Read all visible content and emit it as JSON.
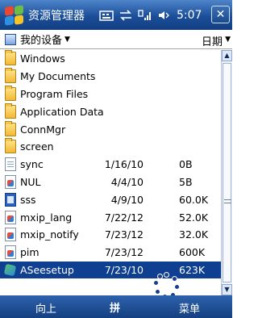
{
  "titlebar": {
    "title": "资源管理器",
    "time": "5:07",
    "close_label": "✕"
  },
  "location": {
    "current": "我的设备",
    "sort_by": "日期"
  },
  "files": [
    {
      "name": "Windows",
      "date": "",
      "size": "",
      "type": "folder"
    },
    {
      "name": "My Documents",
      "date": "",
      "size": "",
      "type": "folder"
    },
    {
      "name": "Program Files",
      "date": "",
      "size": "",
      "type": "folder"
    },
    {
      "name": "Application Data",
      "date": "",
      "size": "",
      "type": "folder"
    },
    {
      "name": "ConnMgr",
      "date": "",
      "size": "",
      "type": "folder"
    },
    {
      "name": "screen",
      "date": "",
      "size": "",
      "type": "folder"
    },
    {
      "name": "sync",
      "date": "1/16/10",
      "size": "0B",
      "type": "doc"
    },
    {
      "name": "NUL",
      "date": "4/4/10",
      "size": "5B",
      "type": "exe"
    },
    {
      "name": "sss",
      "date": "4/9/10",
      "size": "60.0K",
      "type": "sss"
    },
    {
      "name": "mxip_lang",
      "date": "7/22/12",
      "size": "52.0K",
      "type": "exe"
    },
    {
      "name": "mxip_notify",
      "date": "7/23/12",
      "size": "32.0K",
      "type": "exe"
    },
    {
      "name": "pim",
      "date": "7/23/12",
      "size": "600K",
      "type": "exe"
    },
    {
      "name": "ASeesetup",
      "date": "7/23/10",
      "size": "623K",
      "type": "setup",
      "selected": true
    }
  ],
  "softkeys": {
    "left": "向上",
    "center": "拼",
    "right": "菜单"
  },
  "colors": {
    "titlebar": "#1b4e99",
    "selection": "#0e3f91",
    "softkey_bar": "#153f80"
  }
}
